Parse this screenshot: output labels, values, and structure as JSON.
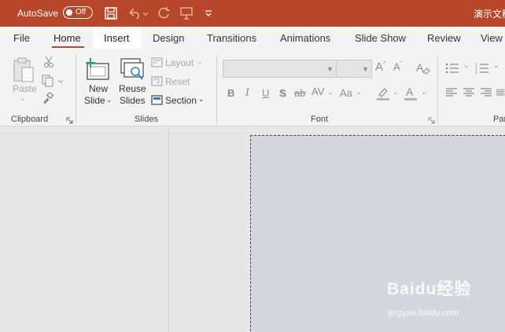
{
  "colors": {
    "accent": "#b7472a",
    "ribbon_bg": "#f3f3f3",
    "workspace_bg": "#e6e6e6",
    "slide_bg": "#d3d6de"
  },
  "titlebar": {
    "autosave_label": "AutoSave",
    "autosave_state": "Off",
    "document_title": "演示文稿"
  },
  "tabs": [
    {
      "label": "File"
    },
    {
      "label": "Home"
    },
    {
      "label": "Insert"
    },
    {
      "label": "Design"
    },
    {
      "label": "Transitions"
    },
    {
      "label": "Animations"
    },
    {
      "label": "Slide Show"
    },
    {
      "label": "Review"
    },
    {
      "label": "View"
    }
  ],
  "ribbon": {
    "clipboard": {
      "group_label": "Clipboard",
      "paste_label": "Paste"
    },
    "slides": {
      "group_label": "Slides",
      "new_slide_line1": "New",
      "new_slide_line2": "Slide",
      "reuse_line1": "Reuse",
      "reuse_line2": "Slides",
      "layout_label": "Layout",
      "reset_label": "Reset",
      "section_label": "Section"
    },
    "font": {
      "group_label": "Font",
      "bold": "B",
      "italic": "I",
      "underline": "U",
      "shadow": "S",
      "strike": "ab",
      "spacing": "AV",
      "change_case": "Aa"
    },
    "paragraph": {
      "group_label": "Par"
    }
  },
  "watermark": {
    "main": "Baidu经验",
    "sub": "jingyan.baidu.com"
  }
}
